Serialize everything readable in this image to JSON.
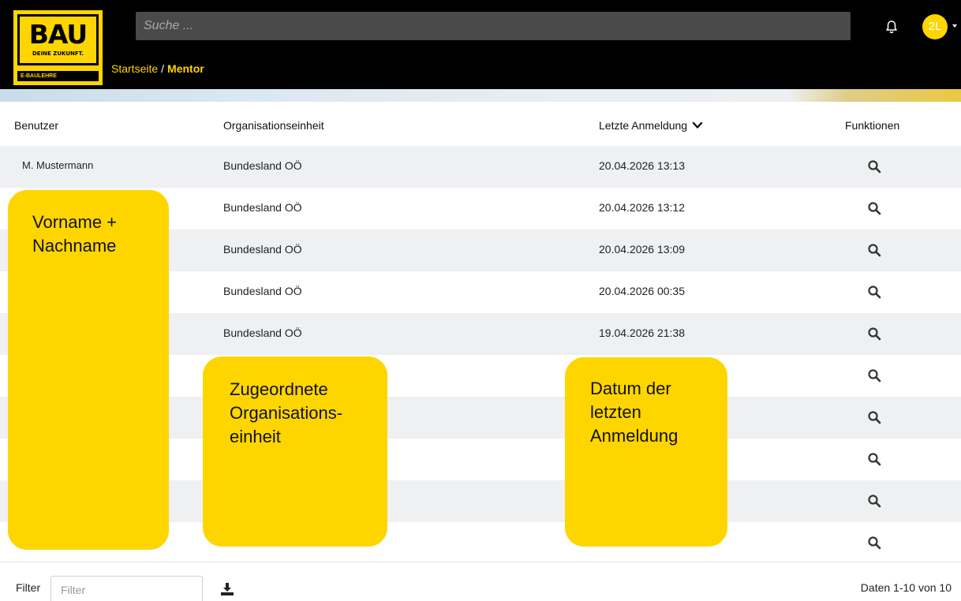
{
  "header": {
    "logo": {
      "main": "BAU",
      "tagline": "DEINE ZUKUNFT.",
      "sub": "E-BAULEHRE"
    },
    "search": {
      "placeholder": "Suche ..."
    },
    "avatar": {
      "initials": "2L"
    },
    "breadcrumb": {
      "home": "Startseite",
      "separator": "/",
      "current": "Mentor"
    }
  },
  "table": {
    "columns": {
      "user": "Benutzer",
      "org": "Organisationseinheit",
      "last_login": "Letzte Anmeldung",
      "functions": "Funktionen"
    },
    "rows": [
      {
        "user": "M. Mustermann",
        "org": "Bundesland OÖ",
        "last_login": "20.04.2026 13:13"
      },
      {
        "user": "",
        "org": "Bundesland OÖ",
        "last_login": "20.04.2026 13:12"
      },
      {
        "user": "",
        "org": "Bundesland OÖ",
        "last_login": "20.04.2026 13:09"
      },
      {
        "user": "",
        "org": "Bundesland OÖ",
        "last_login": "20.04.2026 00:35"
      },
      {
        "user": "",
        "org": "Bundesland OÖ",
        "last_login": "19.04.2026 21:38"
      },
      {
        "user": "",
        "org": "",
        "last_login": ""
      },
      {
        "user": "",
        "org": "",
        "last_login": ""
      },
      {
        "user": "",
        "org": "",
        "last_login": ""
      },
      {
        "user": "",
        "org": "",
        "last_login": ""
      },
      {
        "user": "",
        "org": "",
        "last_login": ""
      }
    ]
  },
  "footer": {
    "filter_label": "Filter",
    "filter_placeholder": "Filter",
    "count": "Daten 1-10 von 10"
  },
  "callouts": {
    "name": "Vorname +\nNachname",
    "org": "Zugeordnete\nOrganisations-\neinheit",
    "date": "Datum der\nletzten\nAnmeldung"
  },
  "colors": {
    "brand_yellow": "#ffd500",
    "header_bg": "#000000",
    "row_alt": "#eef0f2"
  },
  "icons": {
    "notification": "bell-icon",
    "sort": "chevron-down-icon",
    "row_action": "search-icon",
    "export": "download-icon"
  }
}
